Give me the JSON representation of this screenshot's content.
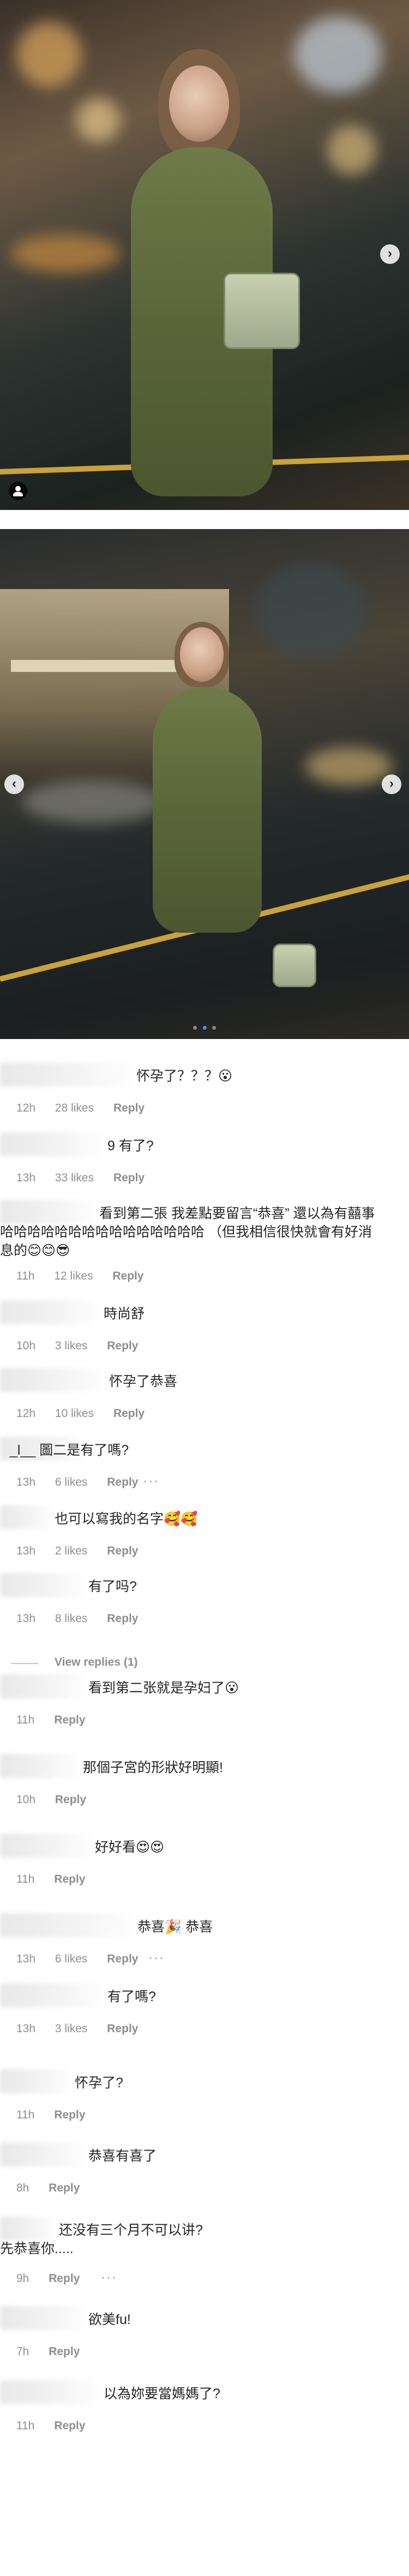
{
  "post": {
    "carousel_dots": 3,
    "active_dot": 2
  },
  "comments": [
    {
      "text": "怀孕了？？？😮",
      "time": "12h",
      "likes": "28 likes",
      "reply": "Reply"
    },
    {
      "text": "9 有了?",
      "time": "13h",
      "likes": "33 likes",
      "reply": "Reply"
    },
    {
      "text": "看到第二張 我差點要留言“恭喜” 還以為有囍事哈哈哈哈哈哈哈哈哈哈哈哈哈哈哈 （但我相信很快就會有好消息的😊😊😎",
      "time": "11h",
      "likes": "12 likes",
      "reply": "Reply"
    },
    {
      "text": "時尚舒",
      "time": "10h",
      "likes": "3 likes",
      "reply": "Reply"
    },
    {
      "text": "怀孕了恭喜",
      "time": "12h",
      "likes": "10 likes",
      "reply": "Reply"
    },
    {
      "text": "_l__ 圖二是有了嗎?",
      "time": "13h",
      "likes": "6 likes",
      "reply": "Reply"
    },
    {
      "text": "也可以寫我的名字🥰🥰",
      "time": "13h",
      "likes": "2 likes",
      "reply": "Reply"
    },
    {
      "text": "有了吗?",
      "time": "13h",
      "likes": "8 likes",
      "reply": "Reply",
      "view_replies": "View replies (1)"
    },
    {
      "text": "看到第二张就是孕妇了😮",
      "time": "11h",
      "likes": "",
      "reply": "Reply"
    },
    {
      "text": "那個子宮的形狀好明顯!",
      "time": "10h",
      "likes": "",
      "reply": "Reply"
    },
    {
      "text": "好好看😍😍",
      "time": "11h",
      "likes": "",
      "reply": "Reply"
    },
    {
      "text": "恭喜🎉 恭喜",
      "time": "13h",
      "likes": "6 likes",
      "reply": "Reply"
    },
    {
      "text": "有了嗎?",
      "time": "13h",
      "likes": "3 likes",
      "reply": "Reply"
    },
    {
      "text": "怀孕了?",
      "time": "11h",
      "likes": "",
      "reply": "Reply"
    },
    {
      "text": "恭喜有喜了",
      "time": "8h",
      "likes": "",
      "reply": "Reply"
    },
    {
      "text": "还没有三个月不可以讲?\n先恭喜你.....",
      "time": "9h",
      "likes": "",
      "reply": "Reply"
    },
    {
      "text": "欲美fu!",
      "time": "7h",
      "likes": "",
      "reply": "Reply"
    },
    {
      "text": "以為妳要當媽媽了?",
      "time": "11h",
      "likes": "",
      "reply": "Reply"
    }
  ],
  "more_label": "···"
}
